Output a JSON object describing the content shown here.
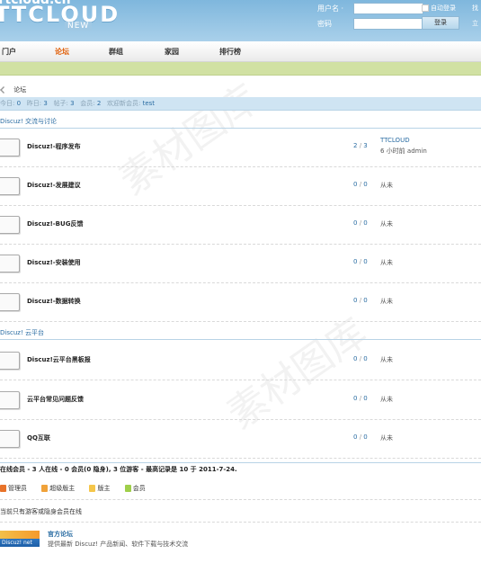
{
  "header": {
    "logo_top": "Ttcloud.cn",
    "logo_main": "TTCLOUD",
    "logo_sub": "NEW"
  },
  "login": {
    "username_label": "用户名 ·",
    "password_label": "密码",
    "username_value": "",
    "password_value": "",
    "auto_login_label": "自动登录",
    "login_button": "登录",
    "cut_right_top": "找",
    "cut_right_bottom": "立"
  },
  "nav": {
    "items": [
      "门户",
      "论坛",
      "群组",
      "家园",
      "排行榜"
    ],
    "active_index": 1
  },
  "breadcrumb": {
    "current": "论坛"
  },
  "stats": {
    "today_label": "今日:",
    "today_value": "0",
    "yesterday_label": "昨日:",
    "yesterday_value": "3",
    "posts_label": "帖子:",
    "posts_value": "3",
    "members_label": "会员:",
    "members_value": "2",
    "newest_label": "欢迎新会员:",
    "newest_member": "test"
  },
  "sections": [
    {
      "title": "Discuz! 交流与讨论",
      "forums": [
        {
          "name": "Discuz!-程序发布",
          "threads": "2",
          "posts": "3",
          "last_title": "TTCLOUD",
          "last_info": "6 小时前 admin"
        },
        {
          "name": "Discuz!-发展建议",
          "threads": "0",
          "posts": "0",
          "last_title": "",
          "last_info": "从未"
        },
        {
          "name": "Discuz!-BUG反馈",
          "threads": "0",
          "posts": "0",
          "last_title": "",
          "last_info": "从未"
        },
        {
          "name": "Discuz!-安装使用",
          "threads": "0",
          "posts": "0",
          "last_title": "",
          "last_info": "从未"
        },
        {
          "name": "Discuz!-数据转换",
          "threads": "0",
          "posts": "0",
          "last_title": "",
          "last_info": "从未"
        }
      ]
    },
    {
      "title": "Discuz! 云平台",
      "forums": [
        {
          "name": "Discuz!云平台黑板报",
          "threads": "0",
          "posts": "0",
          "last_title": "",
          "last_info": "从未"
        },
        {
          "name": "云平台常见问题反馈",
          "threads": "0",
          "posts": "0",
          "last_title": "",
          "last_info": "从未"
        },
        {
          "name": "QQ互联",
          "threads": "0",
          "posts": "0",
          "last_title": "",
          "last_info": "从未"
        }
      ]
    }
  ],
  "online": {
    "summary": "在线会员 - 3 人在线 - 0 会员(0 隐身), 3 位游客 - 最高记录是 10 于 2011-7-24.",
    "legend": [
      {
        "label": "管理员",
        "color": "#e8732a"
      },
      {
        "label": "超级版主",
        "color": "#f0a23a"
      },
      {
        "label": "版主",
        "color": "#f5c64a"
      },
      {
        "label": "会员",
        "color": "#9fcf4a"
      }
    ],
    "note": "当前只有游客或隐身会员在线"
  },
  "friend_link": {
    "badge_text": "Discuz! net",
    "title": "官方论坛",
    "description": "提供最新 Discuz! 产品新闻、软件下载与技术交流"
  },
  "colors": {
    "header_bg": "#8fc0e2",
    "nav_active": "#e05a00",
    "link": "#2b6da3",
    "subbar": "#d1e1a3"
  }
}
